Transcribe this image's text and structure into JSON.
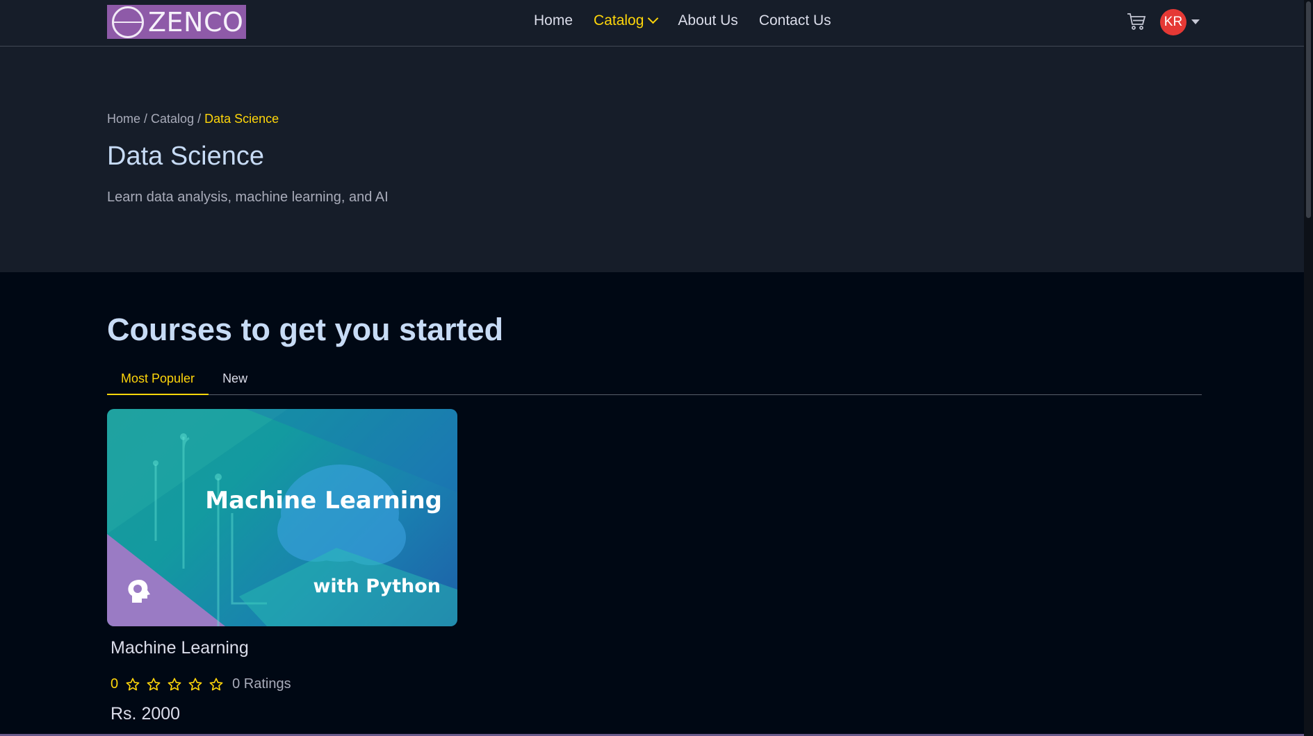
{
  "brand": {
    "name": "ZENCO",
    "logo_color": "#8e5aa8"
  },
  "nav": {
    "links": [
      {
        "label": "Home",
        "active": false
      },
      {
        "label": "Catalog",
        "active": true
      },
      {
        "label": "About Us",
        "active": false
      },
      {
        "label": "Contact Us",
        "active": false
      }
    ],
    "cart_icon": "cart-icon",
    "avatar_initials": "KR"
  },
  "breadcrumb": {
    "home": "Home",
    "catalog": "Catalog",
    "current": "Data Science",
    "separator": "/"
  },
  "page": {
    "title": "Data Science",
    "description": "Learn data analysis, machine learning, and AI"
  },
  "courses_section": {
    "heading": "Courses to get you started",
    "tabs": [
      {
        "label": "Most Populer",
        "active": true
      },
      {
        "label": "New",
        "active": false
      }
    ]
  },
  "course": {
    "thumbnail_title": "Machine Learning",
    "thumbnail_subtitle": "with Python",
    "name": "Machine Learning",
    "rating": "0",
    "stars_filled": 0,
    "stars_total": 5,
    "ratings_label": "0 Ratings",
    "price": "Rs. 2000"
  },
  "colors": {
    "accent": "#ffd60a",
    "nav_bg": "#161d29",
    "page_bg": "#000814",
    "avatar_bg": "#e53935"
  }
}
